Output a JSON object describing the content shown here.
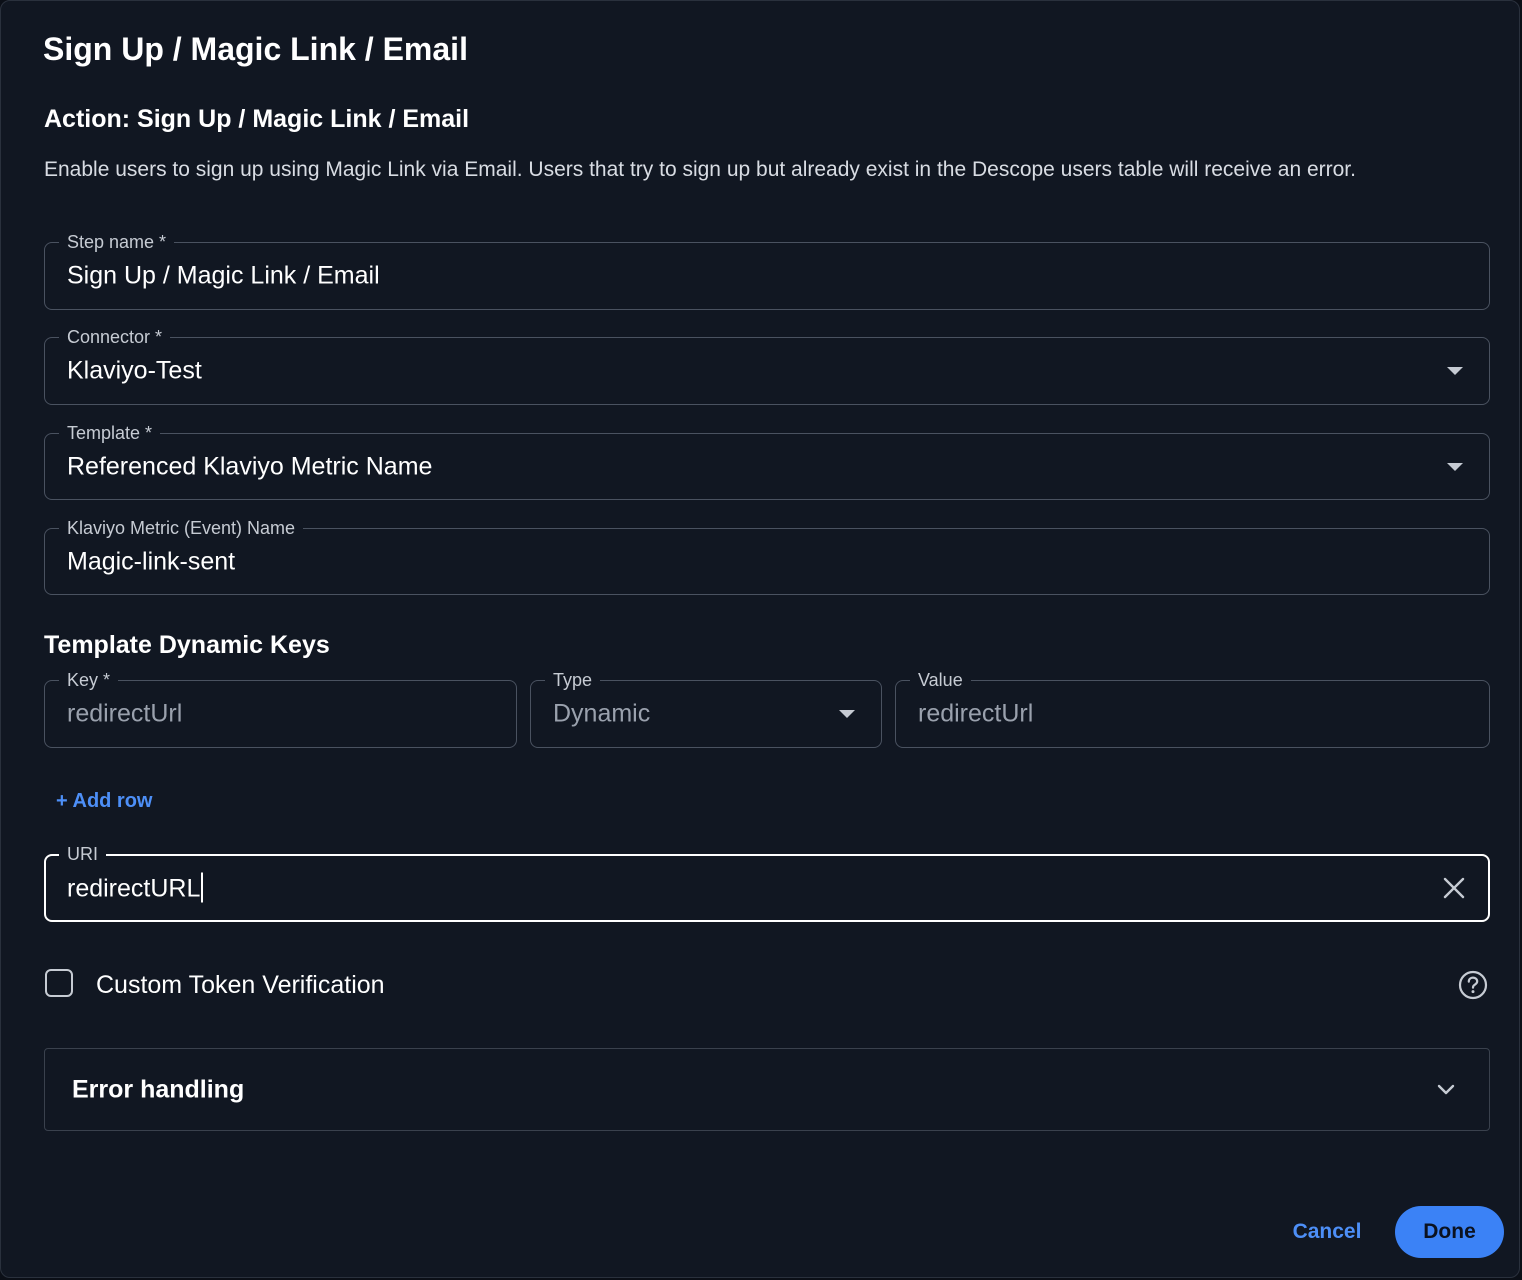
{
  "dialog": {
    "title": "Sign Up / Magic Link / Email",
    "action_title": "Action: Sign Up / Magic Link / Email",
    "description": "Enable users to sign up using Magic Link via Email. Users that try to sign up but already exist in the Descope users table will receive an error."
  },
  "fields": {
    "step_name": {
      "label": "Step name *",
      "value": "Sign Up / Magic Link / Email"
    },
    "connector": {
      "label": "Connector *",
      "value": "Klaviyo-Test"
    },
    "template": {
      "label": "Template *",
      "value": "Referenced Klaviyo Metric Name"
    },
    "metric_name": {
      "label": "Klaviyo Metric (Event) Name",
      "value": "Magic-link-sent"
    }
  },
  "dynamic_keys": {
    "title": "Template Dynamic Keys",
    "row": {
      "key": {
        "label": "Key *",
        "value": "redirectUrl"
      },
      "type": {
        "label": "Type",
        "value": "Dynamic"
      },
      "value": {
        "label": "Value",
        "value": "redirectUrl"
      }
    },
    "add_row_label": "+ Add row"
  },
  "uri": {
    "label": "URI",
    "value": "redirectURL"
  },
  "custom_token": {
    "label": "Custom Token Verification",
    "checked": false
  },
  "error_handling": {
    "label": "Error handling"
  },
  "footer": {
    "cancel_label": "Cancel",
    "done_label": "Done"
  },
  "colors": {
    "background": "#111722",
    "accent": "#3b82f6",
    "link": "#4d8ff7",
    "border": "#4a5260"
  },
  "icons": [
    "caret-down-icon",
    "close-icon",
    "help-icon",
    "chevron-down-icon"
  ]
}
